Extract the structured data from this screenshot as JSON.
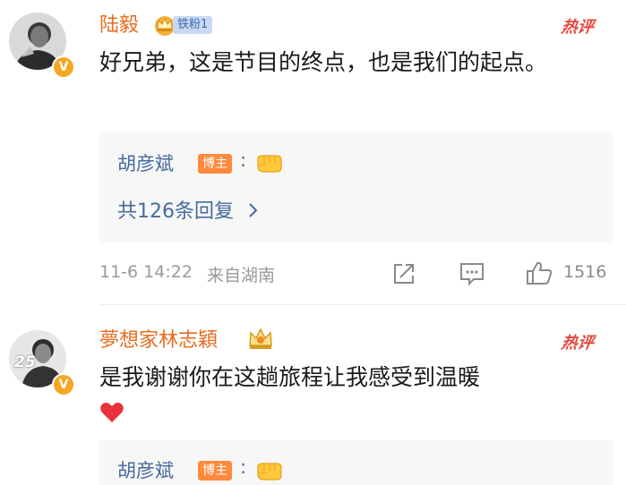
{
  "comments": [
    {
      "username": "陆毅",
      "fan_badge": "铁粉1",
      "hot_label": "热评",
      "text": "好兄弟，这是节目的终点，也是我们的起点。",
      "reply": {
        "author": "胡彦斌",
        "author_tag": "博主",
        "colon": ":",
        "more_label": "共126条回复",
        "more_icon": "chevron-right-icon"
      },
      "timestamp": "11-6 14:22",
      "source": "来自湖南",
      "like_count": "1516"
    },
    {
      "username": "夢想家林志穎",
      "hot_label": "热评",
      "avatar_number": "25",
      "text": "是我谢谢你在这趟旅程让我感受到温暖",
      "reply": {
        "author": "胡彦斌",
        "author_tag": "博主",
        "colon": ":"
      }
    }
  ],
  "icons": {
    "share": "share-icon",
    "comment": "comment-icon",
    "like": "thumbs-up-icon",
    "verified": "verified-v-icon",
    "heart": "red-heart-emoji",
    "crown": "crown-icon",
    "fist": "fist-emoji"
  },
  "colors": {
    "username": "#e86b1f",
    "hot": "#e8473b",
    "reply_link": "#466b9b",
    "meta": "#9a9a9a",
    "bozhu_tag": "#ff8a3d",
    "verified": "#f5a623"
  }
}
